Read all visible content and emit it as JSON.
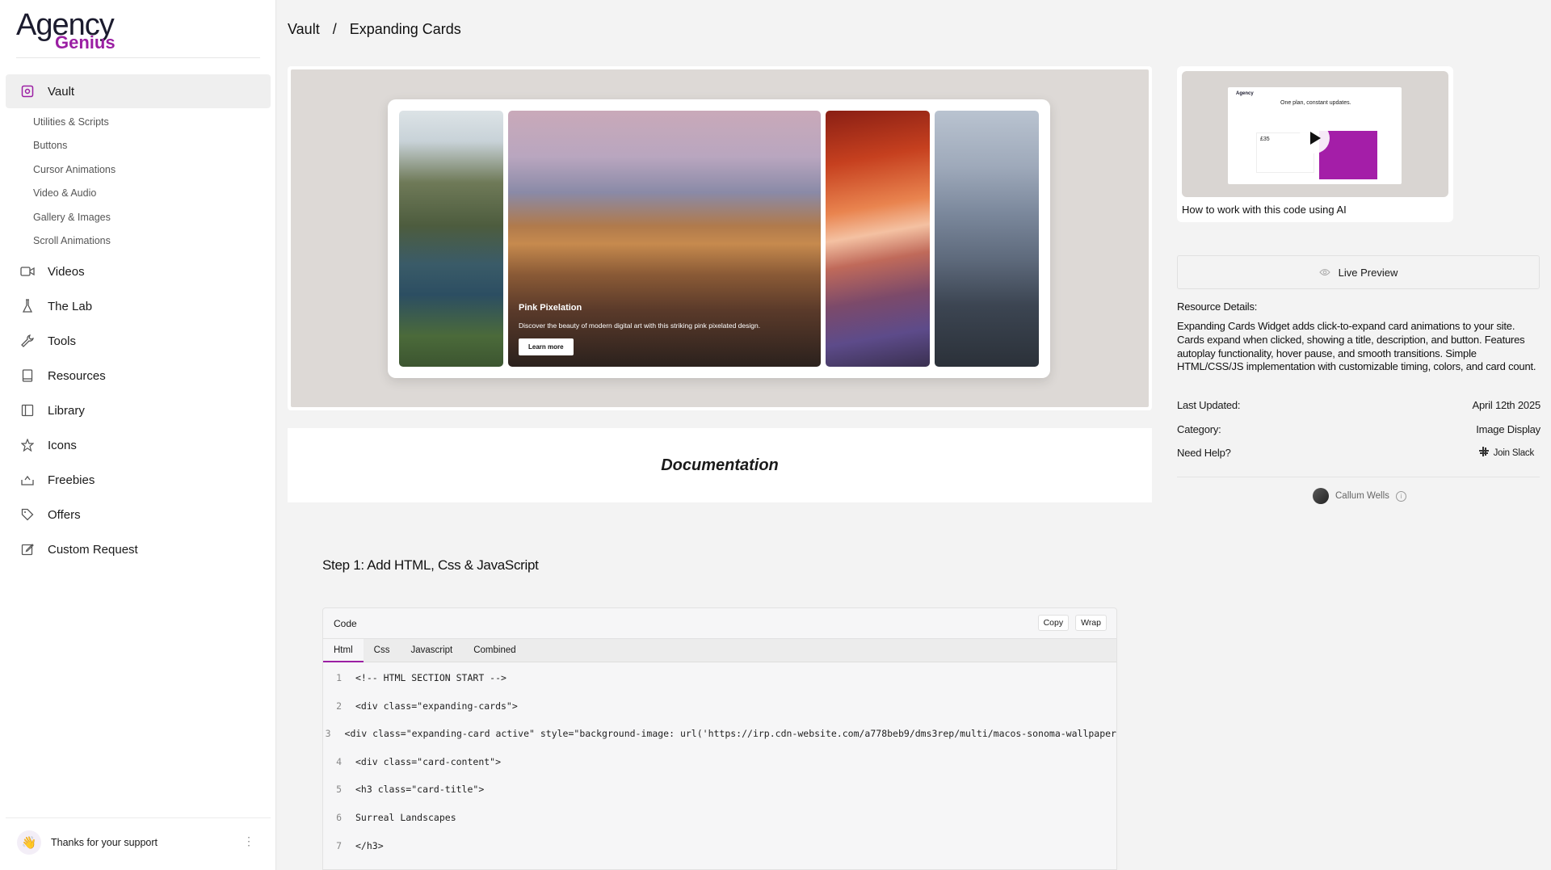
{
  "logo": {
    "line1": "Agency",
    "line2": "Genius"
  },
  "sidebar": {
    "main": {
      "label": "Vault",
      "icon": "vault-icon"
    },
    "subitems": [
      "Utilities & Scripts",
      "Buttons",
      "Cursor Animations",
      "Video & Audio",
      "Gallery & Images",
      "Scroll Animations"
    ],
    "items": [
      {
        "label": "Videos",
        "icon": "video-camera-icon"
      },
      {
        "label": "The Lab",
        "icon": "flask-icon"
      },
      {
        "label": "Tools",
        "icon": "wrench-icon"
      },
      {
        "label": "Resources",
        "icon": "book-icon"
      },
      {
        "label": "Library",
        "icon": "library-icon"
      },
      {
        "label": "Icons",
        "icon": "star-icon"
      },
      {
        "label": "Freebies",
        "icon": "gift-icon"
      },
      {
        "label": "Offers",
        "icon": "tag-icon"
      },
      {
        "label": "Custom Request",
        "icon": "edit-icon"
      }
    ],
    "support": {
      "label": "Thanks for your support",
      "emoji": "👋"
    }
  },
  "breadcrumb": {
    "root": "Vault",
    "separator": "/",
    "current": "Expanding Cards"
  },
  "preview": {
    "card_title": "Pink Pixelation",
    "card_desc": "Discover the beauty of modern digital art with this striking pink pixelated design.",
    "card_button": "Learn more"
  },
  "documentation": {
    "title": "Documentation"
  },
  "step1": {
    "title": "Step 1: Add HTML, Css & JavaScript"
  },
  "code": {
    "header": "Code",
    "copy": "Copy",
    "wrap": "Wrap",
    "tabs": [
      "Html",
      "Css",
      "Javascript",
      "Combined"
    ],
    "active_tab": "Html",
    "lines": [
      "<!-- HTML SECTION START -->",
      "<div class=\"expanding-cards\">",
      "<div class=\"expanding-card active\" style=\"background-image: url('https://irp.cdn-website.com/a778beb9/dms3rep/multi/macos-sonoma-wallpaper",
      "<div class=\"card-content\">",
      "<h3 class=\"card-title\">",
      "Surreal Landscapes",
      "</h3>"
    ]
  },
  "video": {
    "caption": "How to work with this code using AI",
    "thumb_headline": "One plan, constant updates.",
    "thumb_logo": "Agency",
    "thumb_price": "£35"
  },
  "live_preview": {
    "label": "Live Preview"
  },
  "resource": {
    "heading": "Resource Details:",
    "description": "Expanding Cards Widget adds click-to-expand card animations to your site. Cards expand when clicked, showing a title, description, and button. Features autoplay functionality, hover pause, and smooth transitions. Simple HTML/CSS/JS implementation with customizable timing, colors, and card count.",
    "last_updated_label": "Last Updated:",
    "last_updated_value": "April 12th 2025",
    "category_label": "Category:",
    "category_value": "Image Display",
    "help_label": "Need Help?",
    "help_value": "Join Slack"
  },
  "author": {
    "name": "Callum Wells"
  },
  "colors": {
    "accent": "#9b1fa3"
  }
}
